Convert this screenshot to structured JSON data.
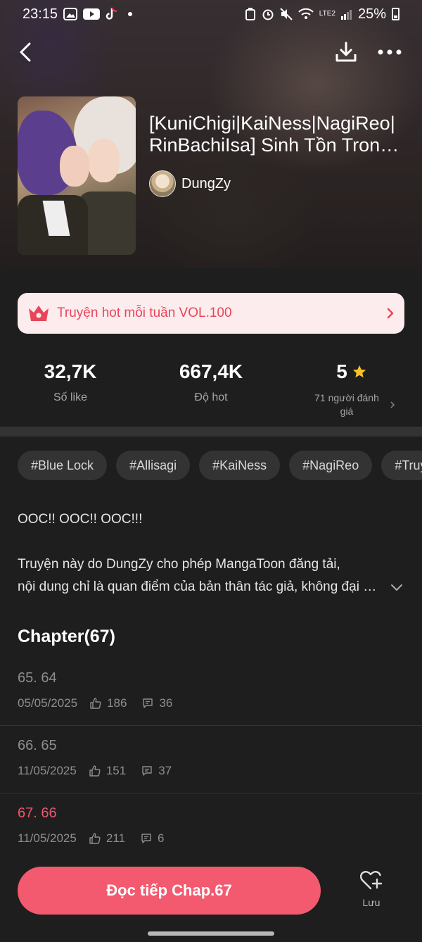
{
  "status_bar": {
    "time": "23:15",
    "battery": "25%",
    "network": "LTE2"
  },
  "nav": {
    "back_icon": "back-arrow-icon",
    "download_icon": "download-icon",
    "more_icon": "more-icon"
  },
  "book": {
    "title_line1": "[KuniChigi|KaiNess|NagiReo|",
    "title_line2": "RinBachiIsa] Sinh Tồn Trong Thế Giới",
    "author": "DungZy"
  },
  "hot_banner": {
    "label": "Truyện hot mỗi tuần VOL.100",
    "color": "#e8455a"
  },
  "stats": {
    "likes": "32,7K",
    "likes_label": "Số like",
    "hot": "667,4K",
    "hot_label": "Độ hot",
    "rating": "5",
    "rating_label": "71 người đánh giá"
  },
  "tags": [
    "#Blue Lock",
    "#Allisagi",
    "#KaiNess",
    "#NagiReo",
    "#TruyenDam"
  ],
  "description": {
    "line1": "OOC!! OOC!! OOC!!!",
    "line2": "Truyện này do DungZy cho phép MangaToon đăng tải,",
    "line3": "nội dung chỉ là quan điểm của bản thân tác giả, không đại diện"
  },
  "chapters": {
    "heading": "Chapter(67)",
    "items": [
      {
        "title": "65. 64",
        "date": "05/05/2025",
        "likes": "186",
        "comments": "36",
        "active": false
      },
      {
        "title": "66. 65",
        "date": "11/05/2025",
        "likes": "151",
        "comments": "37",
        "active": false
      },
      {
        "title": "67. 66",
        "date": "11/05/2025",
        "likes": "211",
        "comments": "6",
        "active": true
      }
    ]
  },
  "bottom": {
    "read_label": "Đọc tiếp Chap.67",
    "save_label": "Lưu",
    "accent": "#f35a6f"
  }
}
